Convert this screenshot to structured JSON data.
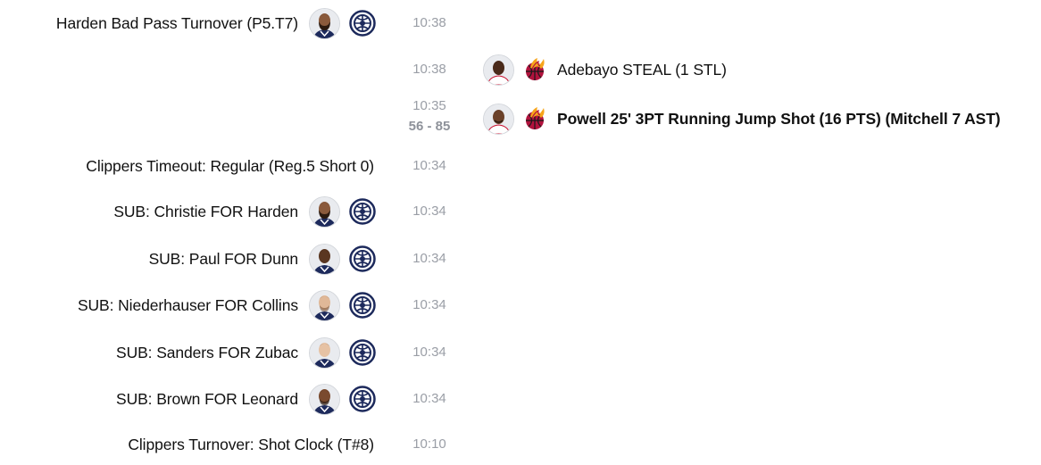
{
  "feed": {
    "colors": {
      "clippers_navy": "#1d2a5c",
      "heat_red": "#b1123d",
      "heat_orange": "#f7a51b",
      "time_gray": "#9a9ea6",
      "jersey_white": "#ffffff",
      "jersey_red": "#c8102e"
    },
    "events": [
      {
        "side": "home",
        "team": "clippers",
        "desc": "Harden Bad Pass Turnover (P5.T7)",
        "time": "10:38",
        "avatar": "player-harden",
        "logo": "clippers-logo-icon"
      },
      {
        "side": "away",
        "team": "heat",
        "desc": "Adebayo STEAL (1 STL)",
        "time": "10:38",
        "avatar": "player-adebayo",
        "logo": "heat-logo-icon"
      },
      {
        "side": "away",
        "team": "heat",
        "desc": "Powell 25' 3PT Running Jump Shot (16 PTS) (Mitchell 7 AST)",
        "time": "10:35",
        "score": "56 - 85",
        "bold": true,
        "avatar": "player-powell",
        "logo": "heat-logo-icon"
      },
      {
        "side": "home",
        "team": "clippers",
        "desc": "Clippers Timeout: Regular (Reg.5 Short 0)",
        "time": "10:34"
      },
      {
        "side": "home",
        "team": "clippers",
        "desc": "SUB: Christie FOR Harden",
        "time": "10:34",
        "avatar": "player-harden",
        "logo": "clippers-logo-icon"
      },
      {
        "side": "home",
        "team": "clippers",
        "desc": "SUB: Paul FOR Dunn",
        "time": "10:34",
        "avatar": "player-dunn",
        "logo": "clippers-logo-icon"
      },
      {
        "side": "home",
        "team": "clippers",
        "desc": "SUB: Niederhauser FOR Collins",
        "time": "10:34",
        "avatar": "player-collins",
        "logo": "clippers-logo-icon"
      },
      {
        "side": "home",
        "team": "clippers",
        "desc": "SUB: Sanders FOR Zubac",
        "time": "10:34",
        "avatar": "player-zubac",
        "logo": "clippers-logo-icon"
      },
      {
        "side": "home",
        "team": "clippers",
        "desc": "SUB: Brown FOR Leonard",
        "time": "10:34",
        "avatar": "player-leonard",
        "logo": "clippers-logo-icon"
      },
      {
        "side": "home",
        "team": "clippers",
        "desc": "Clippers Turnover: Shot Clock (T#8)",
        "time": "10:10"
      }
    ]
  }
}
